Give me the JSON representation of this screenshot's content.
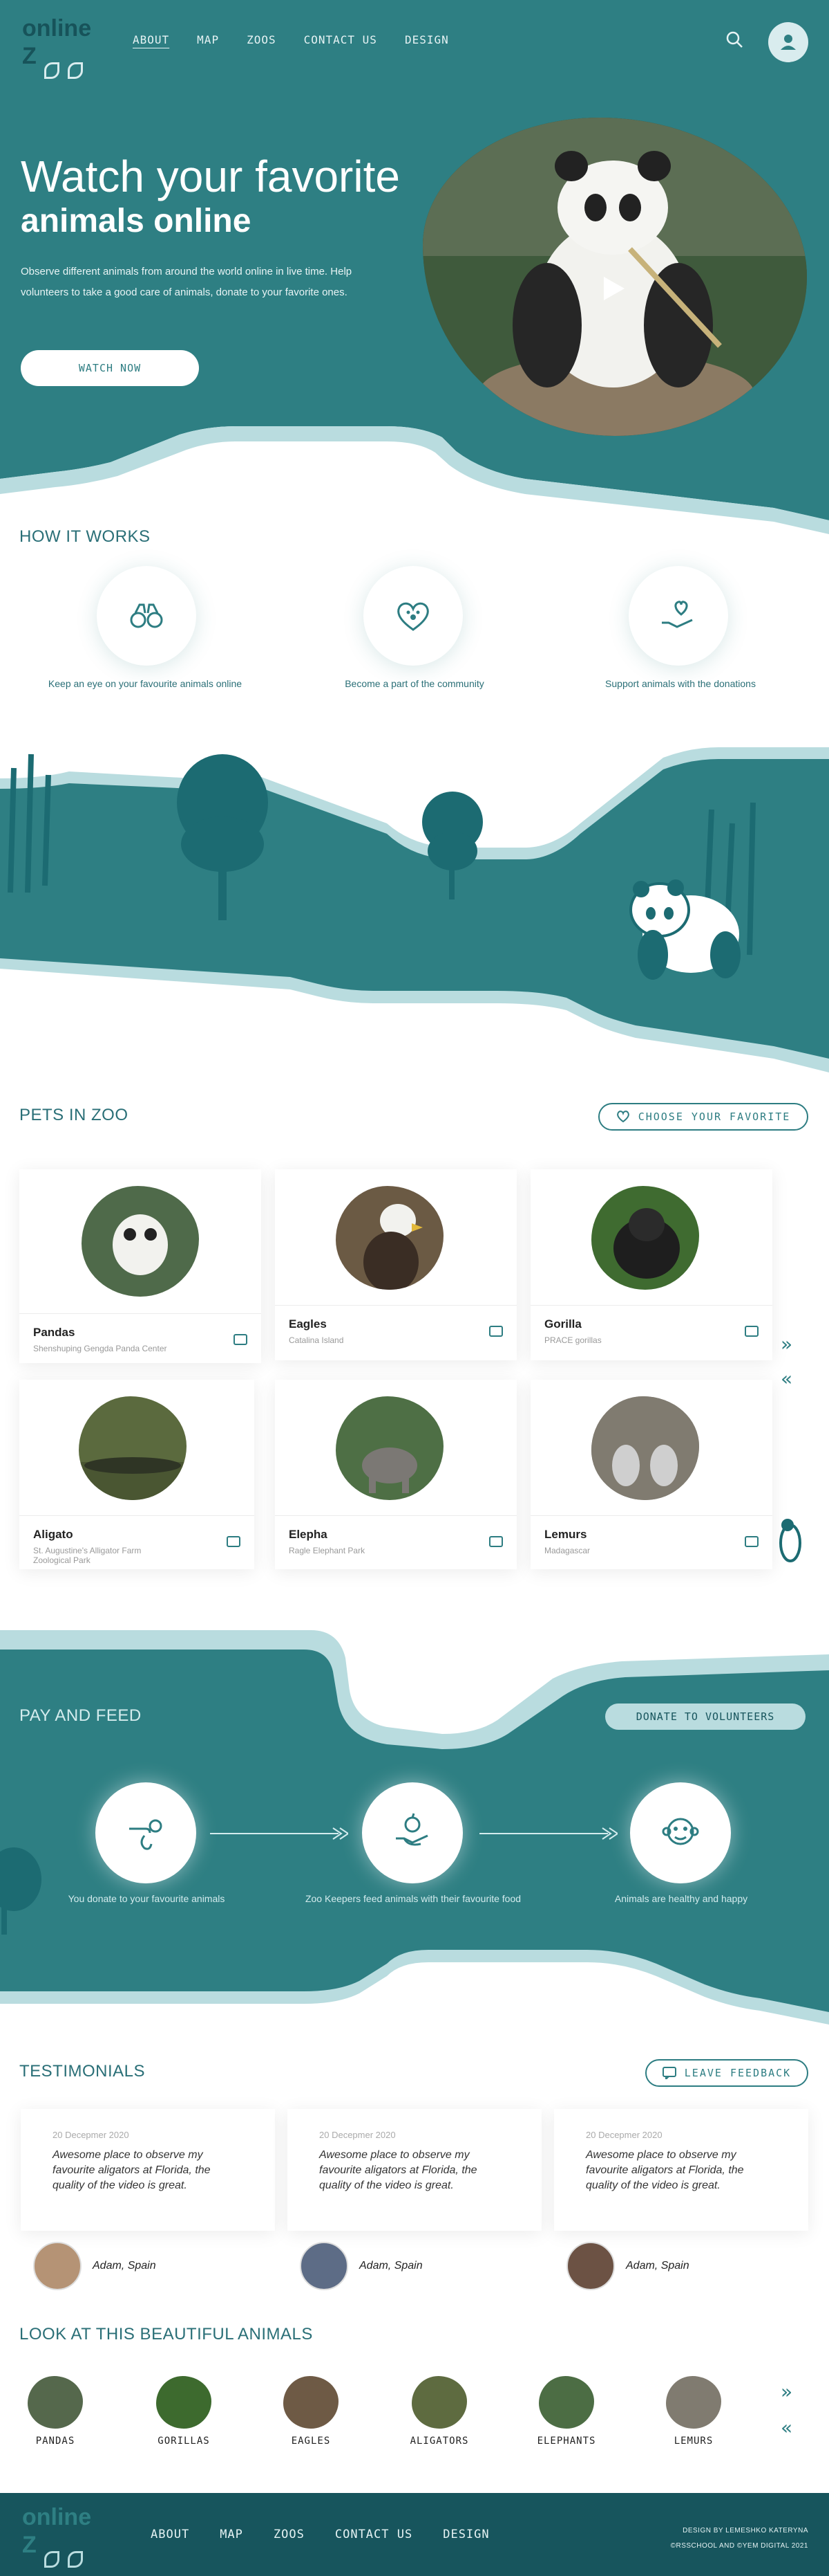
{
  "header": {
    "logo_line1": "online",
    "logo_line2": "Z",
    "nav": [
      "ABOUT",
      "MAP",
      "ZOOS",
      "CONTACT US",
      "DESIGN"
    ],
    "active_nav": "ABOUT"
  },
  "hero": {
    "title_light": "Watch your favorite",
    "title_bold": "animals online",
    "text": "Observe different animals from around the world online in live time. Help volunteers to take a good care of animals, donate to your favorite ones.",
    "cta": "WATCH NOW"
  },
  "how_it_works": {
    "title": "HOW IT WORKS",
    "items": [
      {
        "label": "Keep an eye on your favourite animals online",
        "icon": "binoculars-icon"
      },
      {
        "label": "Become a part of the community",
        "icon": "heart-paw-icon"
      },
      {
        "label": "Support animals with the donations",
        "icon": "hand-heart-icon"
      }
    ]
  },
  "pets": {
    "title": "PETS IN ZOO",
    "choose_button": "CHOOSE YOUR FAVORITE",
    "cards": [
      {
        "name": "Pandas",
        "place": "Shenshuping Gengda Panda Center",
        "color": "#4f6a4a"
      },
      {
        "name": "Eagles",
        "place": "Catalina Island",
        "color": "#6b5a44"
      },
      {
        "name": "Gorilla",
        "place": "PRACE gorillas",
        "color": "#3f6b30"
      },
      {
        "name": "Aligato",
        "place": "St. Augustine's Alligator Farm Zoological Park",
        "color": "#5b6a3e"
      },
      {
        "name": "Elepha",
        "place": "Ragle Elephant Park",
        "color": "#4e6f45"
      },
      {
        "name": "Lemurs",
        "place": "Madagascar",
        "color": "#7d7a6f"
      }
    ]
  },
  "pay_feed": {
    "title": "PAY AND FEED",
    "donate_button": "DONATE TO VOLUNTEERS",
    "steps": [
      {
        "label": "You donate to your favourite animals",
        "icon": "hand-coin-icon"
      },
      {
        "label": "Zoo Keepers feed animals with their favourite food",
        "icon": "hand-apple-icon"
      },
      {
        "label": "Animals are healthy and happy",
        "icon": "monkey-face-icon"
      }
    ]
  },
  "testimonials": {
    "title": "TESTIMONIALS",
    "feedback_button": "LEAVE FEEDBACK",
    "items": [
      {
        "date": "20 Decepmer 2020",
        "text": "Awesome place to observe my favourite aligators at Florida, the quality of the video is great.",
        "author": "Adam, Spain",
        "avatar_color": "#b59375"
      },
      {
        "date": "20 Decepmer 2020",
        "text": "Awesome place to observe my favourite aligators at Florida, the quality of the video is great.",
        "author": "Adam, Spain",
        "avatar_color": "#5d6c86"
      },
      {
        "date": "20 Decepmer 2020",
        "text": "Awesome place to observe my favourite aligators at Florida, the quality of the video is great.",
        "author": "Adam, Spain",
        "avatar_color": "#6c5244"
      }
    ]
  },
  "gallery": {
    "title": "LOOK AT THIS BEAUTIFUL ANIMALS",
    "items": [
      {
        "label": "PANDAS",
        "color": "#55684c"
      },
      {
        "label": "GORILLAS",
        "color": "#3d6a2e"
      },
      {
        "label": "EAGLES",
        "color": "#6e5a45"
      },
      {
        "label": "ALIGATORS",
        "color": "#5e6b40"
      },
      {
        "label": "ELEPHANTS",
        "color": "#4c6d44"
      },
      {
        "label": "LEMURS",
        "color": "#807b70"
      }
    ]
  },
  "footer": {
    "nav": [
      "ABOUT",
      "MAP",
      "ZOOS",
      "CONTACT US",
      "DESIGN"
    ],
    "credit1": "DESIGN BY LEMESHKO KATERYNA",
    "credit2": "©RSSCHOOL AND ©YEM DIGITAL 2021"
  },
  "colors": {
    "primary": "#2e7f83",
    "dark": "#17555d",
    "light": "#b9dcdf"
  }
}
